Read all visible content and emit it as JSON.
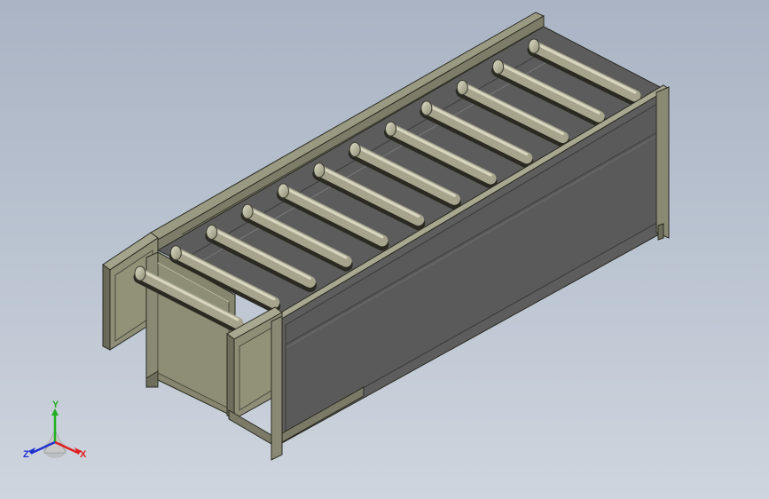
{
  "scene": {
    "background_top": "#aab4c4",
    "background_bottom": "#cfd5de",
    "model_face_color": "#8e8e76",
    "model_dark_color": "#5a5a5a",
    "roller_count": 12,
    "roller_color": "#a6a48c"
  },
  "triad": {
    "x_label": "X",
    "y_label": "Y",
    "z_label": "Z",
    "x_color": "#e02020",
    "y_color": "#20b020",
    "z_color": "#2030d0"
  }
}
